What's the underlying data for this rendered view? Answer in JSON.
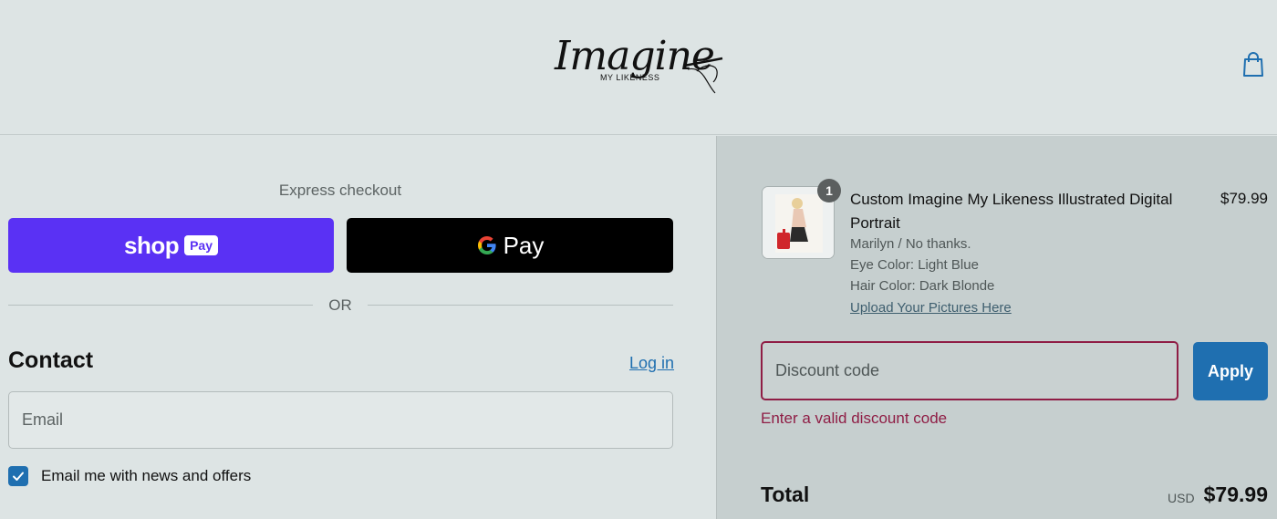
{
  "header": {
    "logo_script": "Imagine",
    "logo_sub": "MY  LIKENESS"
  },
  "express": {
    "label": "Express checkout",
    "shop_word": "shop",
    "shop_chip": "Pay",
    "gpay_word": "Pay",
    "or_text": "OR"
  },
  "contact": {
    "title": "Contact",
    "login": "Log in",
    "email_placeholder": "Email",
    "news_label": "Email me with news and offers",
    "news_checked": true
  },
  "order": {
    "quantity_badge": "1",
    "item_title": "Custom Imagine My Likeness Illustrated Digital Portrait",
    "item_price": "$79.99",
    "props": [
      "Marilyn / No thanks.",
      "Eye Color: Light Blue",
      "Hair Color: Dark Blonde"
    ],
    "upload_link": "Upload Your Pictures Here",
    "discount_placeholder": "Discount code",
    "apply_label": "Apply",
    "discount_error": "Enter a valid discount code",
    "total_label": "Total",
    "total_currency": "USD",
    "total_value": "$79.99"
  },
  "colors": {
    "shop_pay": "#5a31f4",
    "accent": "#1f6fb0",
    "error": "#8f1d45"
  }
}
